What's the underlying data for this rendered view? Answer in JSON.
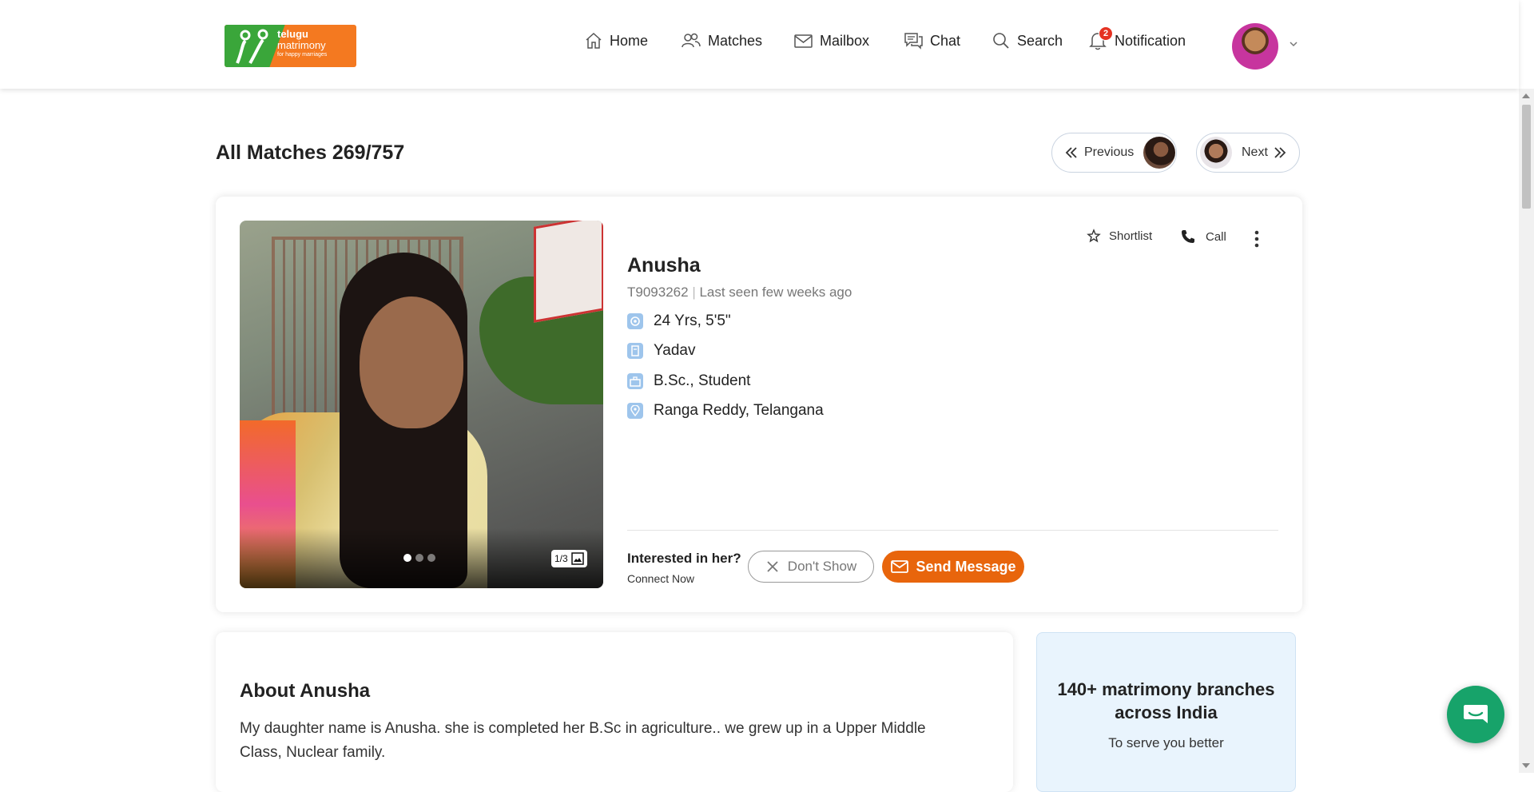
{
  "brand": {
    "line1": "telugu",
    "line2": "matrimony",
    "line3": "for happy marriages",
    "colors": {
      "orange": "#f47920",
      "green": "#3aa63a"
    }
  },
  "nav": {
    "home": "Home",
    "matches": "Matches",
    "mailbox": "Mailbox",
    "chat": "Chat",
    "search": "Search",
    "notification": "Notification",
    "notification_count": "2"
  },
  "page": {
    "title": "All Matches 269/757",
    "previous_label": "Previous",
    "next_label": "Next"
  },
  "profile": {
    "name": "Anusha",
    "id": "T9093262",
    "last_seen": "Last seen few weeks ago",
    "age_height": "24 Yrs, 5'5\"",
    "caste": "Yadav",
    "education_occupation": "B.Sc., Student",
    "location": "Ranga Reddy, Telangana",
    "photo_counter": "1/3",
    "photo_count": 3,
    "active_photo": 1
  },
  "actions": {
    "shortlist": "Shortlist",
    "call": "Call",
    "interested": "Interested in her?",
    "connect_now": "Connect Now",
    "dont_show": "Don't Show",
    "send_message": "Send Message",
    "accent_color": "#e8650c"
  },
  "about": {
    "title": "About Anusha",
    "text": "My daughter name is Anusha. she is completed her B.Sc in agriculture.. we grew up in a Upper Middle Class, Nuclear family."
  },
  "branches": {
    "title": "140+ matrimony branches across India",
    "subtitle": "To serve you better"
  }
}
